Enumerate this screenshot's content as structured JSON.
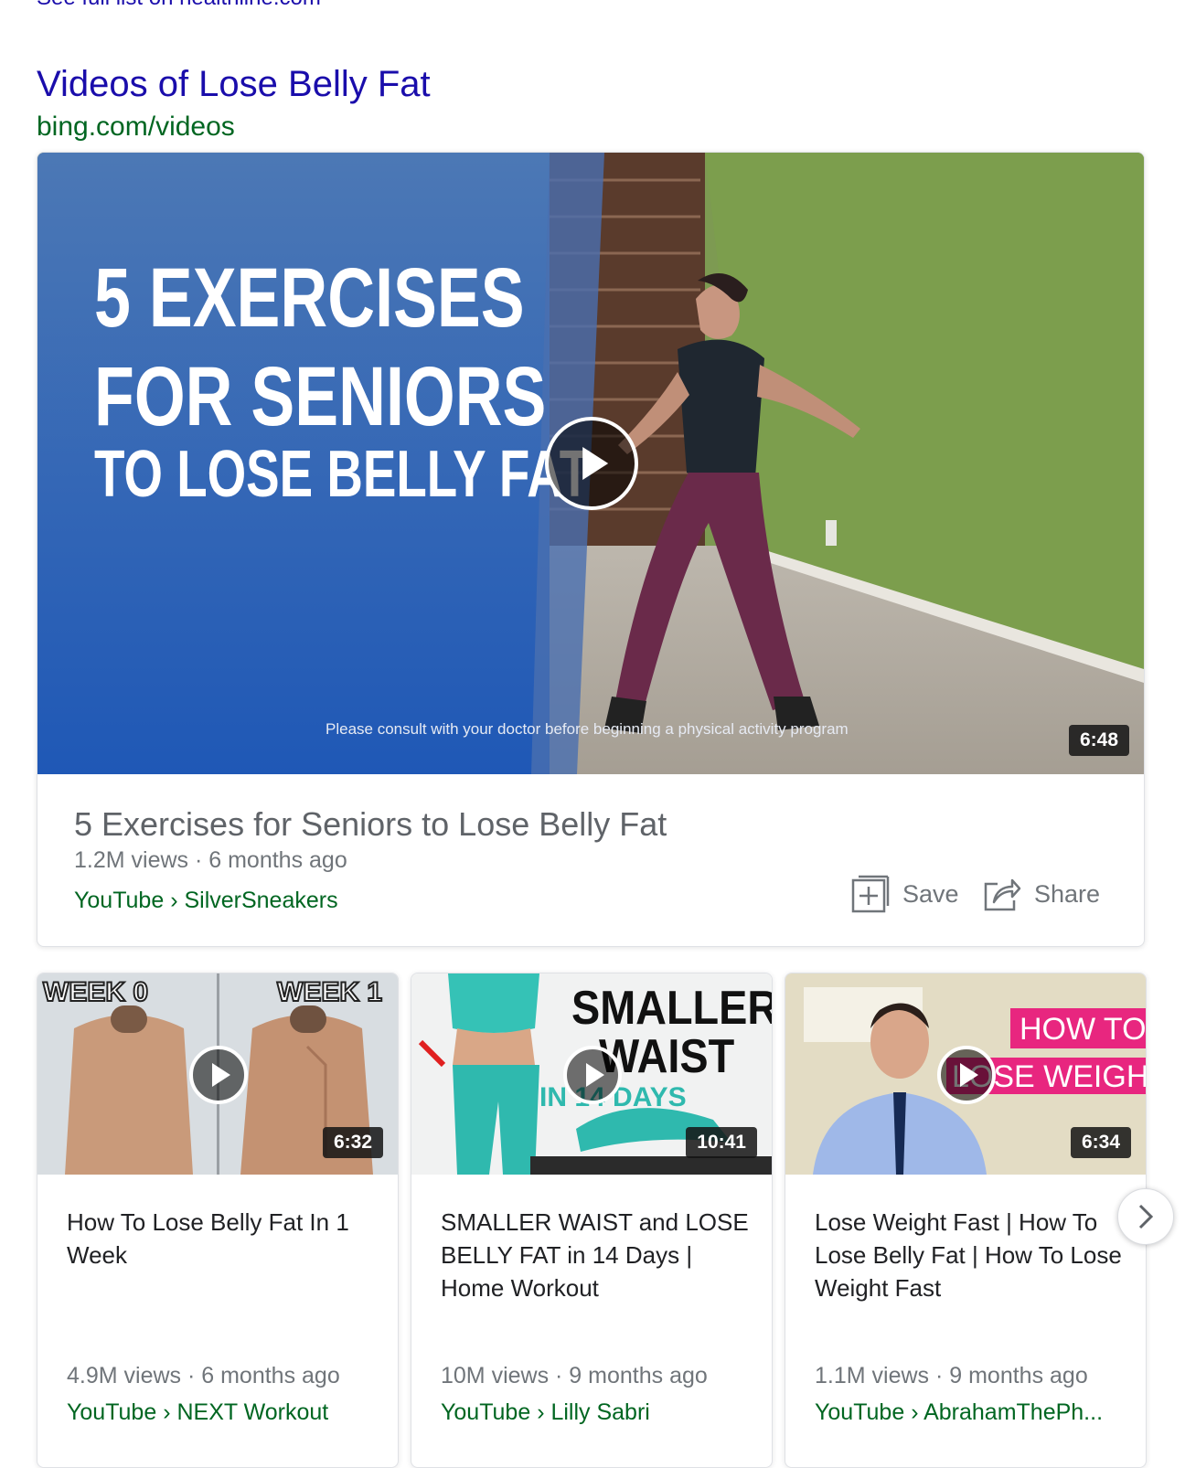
{
  "top_link": "See full list on healthline.com",
  "section": {
    "title": "Videos of Lose Belly Fat",
    "source": "bing.com/videos"
  },
  "featured": {
    "thumb_text": [
      "5 EXERCISES",
      "FOR SENIORS",
      "TO LOSE BELLY FAT"
    ],
    "disclaimer": "Please consult with your doctor before beginning a physical activity program",
    "duration": "6:48",
    "title": "5 Exercises for Seniors to Lose Belly Fat",
    "meta": "1.2M views · 6 months ago",
    "source": "YouTube › SilverSneakers",
    "save_label": "Save",
    "share_label": "Share"
  },
  "videos": [
    {
      "thumb_labels": [
        "WEEK 0",
        "WEEK 1"
      ],
      "duration": "6:32",
      "title": "How To Lose Belly Fat In 1 Week",
      "meta": "4.9M views · 6 months ago",
      "source": "YouTube › NEXT Workout"
    },
    {
      "thumb_labels": [
        "SMALLER",
        "WAIST",
        "IN 14 DAYS"
      ],
      "duration": "10:41",
      "title": "SMALLER WAIST and LOSE BELLY FAT in 14 Days | Home Workout",
      "meta": "10M views · 9 months ago",
      "source": "YouTube › Lilly Sabri"
    },
    {
      "thumb_labels": [
        "HOW TO",
        "LOSE WEIGHT"
      ],
      "duration": "6:34",
      "title": "Lose Weight Fast | How To Lose Belly Fat | How To Lose Weight Fast",
      "meta": "1.1M views · 9 months ago",
      "source": "YouTube › AbrahamThePh..."
    }
  ]
}
